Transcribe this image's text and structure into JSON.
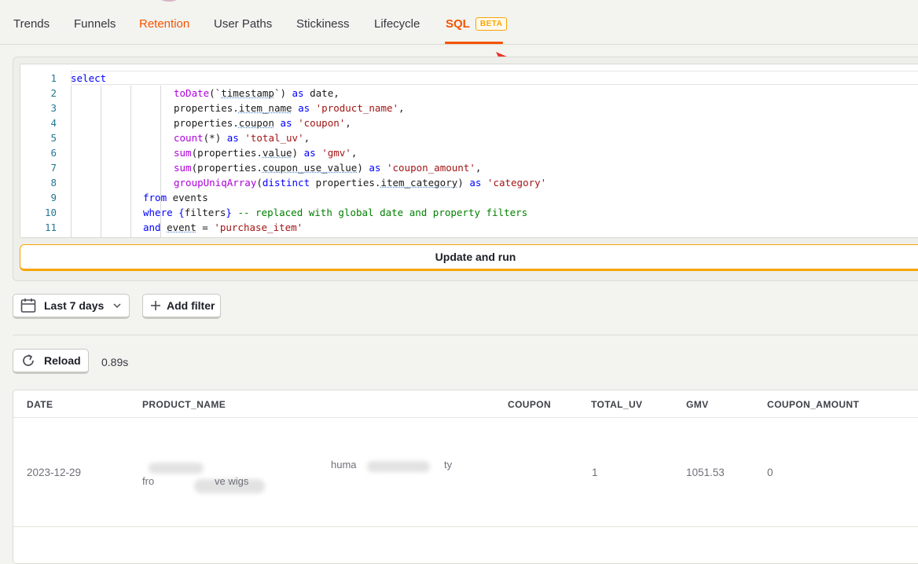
{
  "tabs": [
    {
      "label": "Trends"
    },
    {
      "label": "Funnels"
    },
    {
      "label": "Retention"
    },
    {
      "label": "User Paths"
    },
    {
      "label": "Stickiness"
    },
    {
      "label": "Lifecycle"
    },
    {
      "label": "SQL",
      "badge": "BETA",
      "active": true
    }
  ],
  "colors": {
    "accent": "#f35400",
    "badge": "#f7a501",
    "annotation_arrow": "#e8332a"
  },
  "editor": {
    "line_numbers": [
      "1",
      "2",
      "3",
      "4",
      "5",
      "6",
      "7",
      "8",
      "9",
      "10",
      "11"
    ],
    "lines": [
      "select",
      "toDate(`timestamp`) as date,",
      "properties.item_name as 'product_name',",
      "properties.coupon as 'coupon',",
      "count(*) as 'total_uv',",
      "sum(properties.value) as 'gmv',",
      "sum(properties.coupon_use_value) as 'coupon_amount',",
      "groupUniqArray(distinct properties.item_category) as 'category'",
      "from events",
      "where {filters} -- replaced with global date and property filters",
      "and event = 'purchase_item'"
    ],
    "run_button": "Update and run"
  },
  "filters": {
    "date_range": "Last 7 days",
    "add_filter": "Add filter",
    "icons": [
      "calendar-icon",
      "chevron-down-icon",
      "plus-icon"
    ]
  },
  "results": {
    "reload": "Reload",
    "reload_icon": "refresh-icon",
    "duration": "0.89s",
    "columns": [
      "DATE",
      "PRODUCT_NAME",
      "COUPON",
      "TOTAL_UV",
      "GMV",
      "COUPON_AMOUNT"
    ],
    "rows": [
      {
        "date": "2023-12-29",
        "product_name_fragments": [
          "huma",
          "ty",
          "fro",
          "ve wigs"
        ],
        "coupon": "",
        "total_uv": "1",
        "gmv": "1051.53",
        "coupon_amount": "0"
      }
    ]
  }
}
